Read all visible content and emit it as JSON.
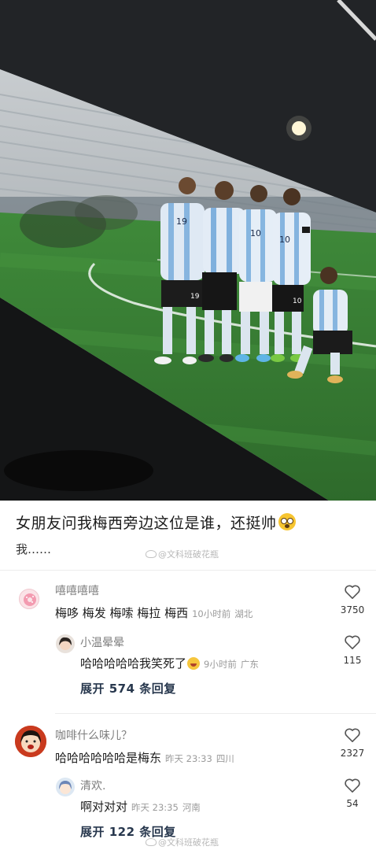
{
  "post": {
    "title": "女朋友问我梅西旁边这位是谁，还挺帅",
    "subtitle": "我……",
    "watermark": "@文科班破花瓶"
  },
  "photo": {
    "jersey_numbers": [
      "19",
      "19",
      "10",
      "10",
      "10"
    ]
  },
  "comments": [
    {
      "name": "嘻嘻嘻嘻",
      "text": "梅哆 梅发 梅嗦 梅拉 梅西",
      "time": "10小时前",
      "location": "湖北",
      "likes": "3750",
      "reply": {
        "name": "小温晕晕",
        "text": "哈哈哈哈哈我笑死了",
        "time": "9小时前",
        "location": "广东",
        "likes": "115"
      },
      "expand": "展开 574 条回复"
    },
    {
      "name": "咖啡什么味儿？",
      "text": "哈哈哈哈哈哈是梅东",
      "time": "昨天 23:33",
      "location": "四川",
      "likes": "2327",
      "reply": {
        "name": "清欢.",
        "text": "啊对对对",
        "time": "昨天 23:35",
        "location": "河南",
        "likes": "54"
      },
      "expand": "展开 122 条回复"
    }
  ],
  "icons": {
    "like": "heart-outline-icon",
    "emoji_post": "flushed-face-icon",
    "emoji_reply": "crying-laughing-icon"
  },
  "colors": {
    "expand_link": "#27374d",
    "meta_gray": "#9a9a9a",
    "name_gray": "#7e7e7e"
  }
}
